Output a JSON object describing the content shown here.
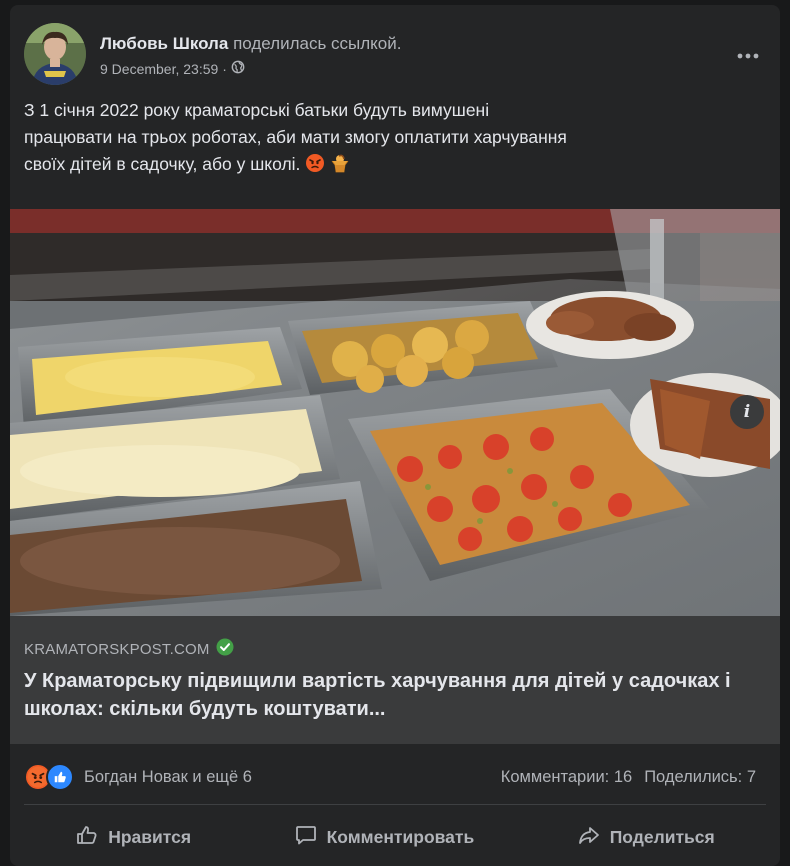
{
  "post": {
    "author": "Любовь Школа",
    "action": "поделилась ссылкой.",
    "timestamp": "9 December, 23:59",
    "separator": "·",
    "text_line1": "З 1 січня 2022 року краматорські батьки будуть вимушені",
    "text_line2": "працювати на трьох роботах, аби мати змогу оплатити харчування",
    "text_line3": "своїх дітей в садочку, або у школі."
  },
  "link": {
    "domain": "KRAMATORSKPOST.COM",
    "title": "У Краматорську підвищили вартість харчування для дітей у садочках і школах: скільки будуть коштувати...",
    "info_label": "i"
  },
  "stats": {
    "reactors": "Богдан Новак и ещё 6",
    "comments": "Комментарии: 16",
    "shares": "Поделились: 7"
  },
  "actions": {
    "like": "Нравится",
    "comment": "Комментировать",
    "share": "Поделиться"
  },
  "colors": {
    "background": "#18191a",
    "card": "#242526",
    "link_box": "#3a3b3c",
    "text_primary": "#e4e6eb",
    "text_secondary": "#b0b3b8",
    "like_blue": "#2d88ff",
    "verified_green": "#43a047"
  },
  "icons": {
    "privacy": "globe-icon",
    "menu": "more-dots-icon",
    "verified": "verified-check-icon",
    "reaction_1": "angry-reaction-icon",
    "reaction_2": "like-reaction-icon",
    "like": "thumbs-up-icon",
    "comment": "comment-bubble-icon",
    "share": "share-arrow-icon"
  }
}
